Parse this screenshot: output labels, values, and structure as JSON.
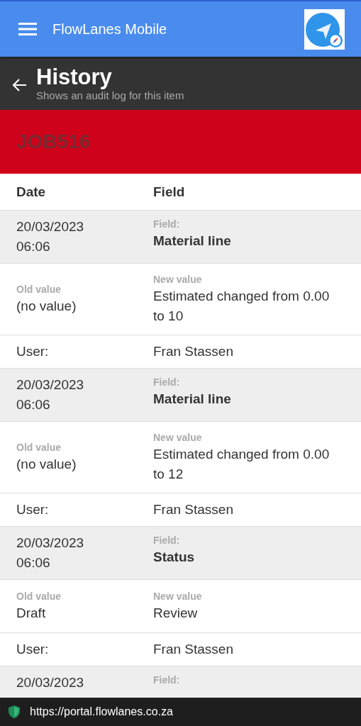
{
  "app_bar": {
    "title": "FlowLanes Mobile"
  },
  "page_header": {
    "title": "History",
    "subtitle": "Shows an audit log for this item"
  },
  "banner": {
    "title": "JOB516"
  },
  "table": {
    "columns": [
      "Date",
      "Field"
    ],
    "entries": [
      {
        "date": "20/03/2023",
        "time": "06:06",
        "field_label": "Field:",
        "field": "Material line",
        "old_label": "Old value",
        "old_value": "(no value)",
        "new_label": "New value",
        "new_value": "Estimated changed from 0.00 to 10",
        "user_label": "User:",
        "user": "Fran Stassen"
      },
      {
        "date": "20/03/2023",
        "time": "06:06",
        "field_label": "Field:",
        "field": "Material line",
        "old_label": "Old value",
        "old_value": "(no value)",
        "new_label": "New value",
        "new_value": "Estimated changed from 0.00 to 12",
        "user_label": "User:",
        "user": "Fran Stassen"
      },
      {
        "date": "20/03/2023",
        "time": "06:06",
        "field_label": "Field:",
        "field": "Status",
        "old_label": "Old value",
        "old_value": "Draft",
        "new_label": "New value",
        "new_value": "Review",
        "user_label": "User:",
        "user": "Fran Stassen"
      },
      {
        "date": "20/03/2023",
        "field_label": "Field:"
      }
    ]
  },
  "browser_bar": {
    "url": "https://portal.flowlanes.co.za"
  }
}
